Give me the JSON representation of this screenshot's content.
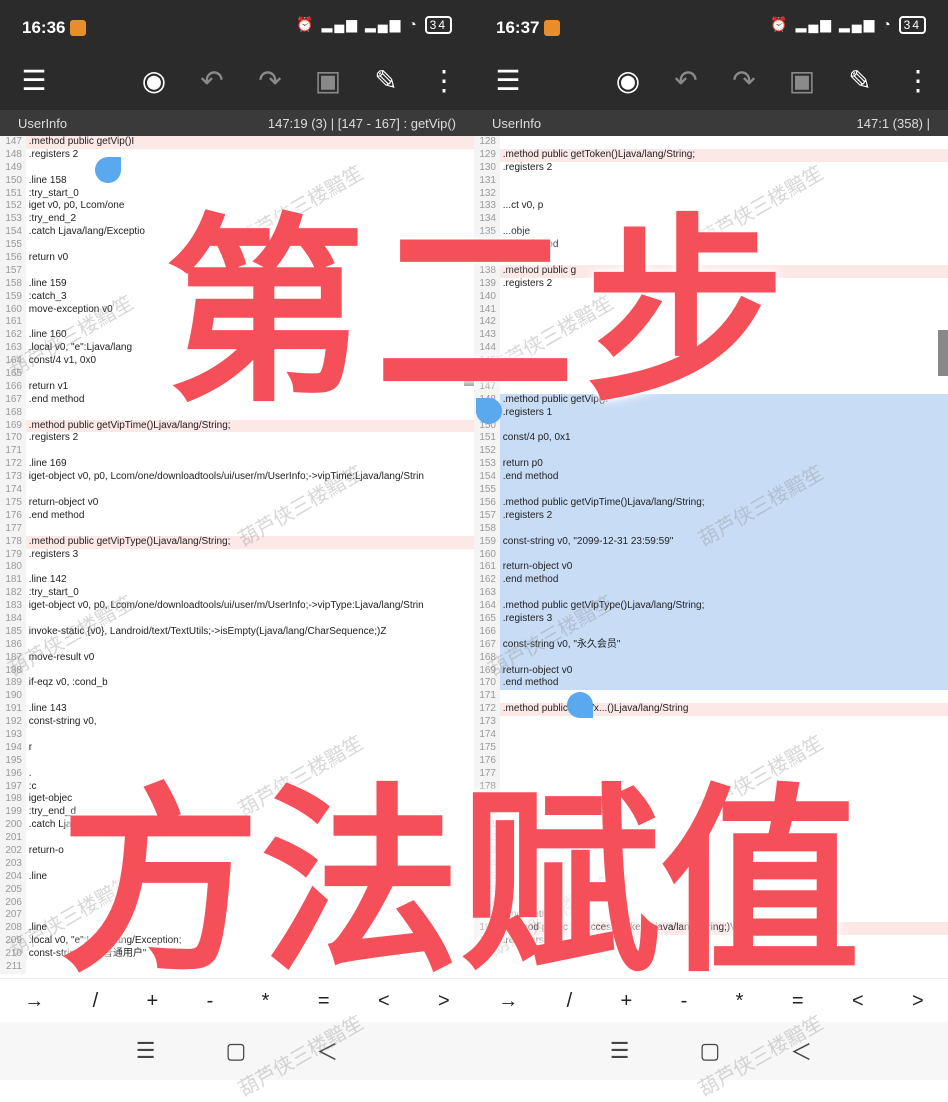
{
  "left": {
    "status_time": "16:36",
    "file": "UserInfo",
    "pos": "147:19 (3)  |  [147 - 167] : getVip()",
    "lines": [
      {
        "n": "147",
        "t": ".method public getVip()I",
        "c": "hl"
      },
      {
        "n": "148",
        "t": "    .registers 2"
      },
      {
        "n": "149",
        "t": ""
      },
      {
        "n": "150",
        "t": "    .line 158"
      },
      {
        "n": "151",
        "t": "    :try_start_0"
      },
      {
        "n": "152",
        "t": "    iget v0, p0, Lcom/one"
      },
      {
        "n": "153",
        "t": "    :try_end_2"
      },
      {
        "n": "154",
        "t": "    .catch Ljava/lang/Exceptio"
      },
      {
        "n": "155",
        "t": ""
      },
      {
        "n": "156",
        "t": "    return v0"
      },
      {
        "n": "157",
        "t": ""
      },
      {
        "n": "158",
        "t": "    .line 159"
      },
      {
        "n": "159",
        "t": "    :catch_3"
      },
      {
        "n": "160",
        "t": "    move-exception v0"
      },
      {
        "n": "161",
        "t": ""
      },
      {
        "n": "162",
        "t": "    .line 160"
      },
      {
        "n": "163",
        "t": "    .local v0, \"e\":Ljava/lang"
      },
      {
        "n": "164",
        "t": "    const/4 v1, 0x0"
      },
      {
        "n": "165",
        "t": ""
      },
      {
        "n": "166",
        "t": "    return v1"
      },
      {
        "n": "167",
        "t": ".end method"
      },
      {
        "n": "168",
        "t": ""
      },
      {
        "n": "169",
        "t": ".method public getVipTime()Ljava/lang/String;",
        "c": "hl"
      },
      {
        "n": "170",
        "t": "    .registers 2"
      },
      {
        "n": "171",
        "t": ""
      },
      {
        "n": "172",
        "t": "    .line 169"
      },
      {
        "n": "173",
        "t": "    iget-object v0, p0, Lcom/one/downloadtools/ui/user/m/UserInfo;->vipTime:Ljava/lang/Strin"
      },
      {
        "n": "174",
        "t": ""
      },
      {
        "n": "175",
        "t": "    return-object v0"
      },
      {
        "n": "176",
        "t": ".end method"
      },
      {
        "n": "177",
        "t": ""
      },
      {
        "n": "178",
        "t": ".method public getVipType()Ljava/lang/String;",
        "c": "hl"
      },
      {
        "n": "179",
        "t": "    .registers 3"
      },
      {
        "n": "180",
        "t": ""
      },
      {
        "n": "181",
        "t": "    .line 142"
      },
      {
        "n": "182",
        "t": "    :try_start_0"
      },
      {
        "n": "183",
        "t": "    iget-object v0, p0, Lcom/one/downloadtools/ui/user/m/UserInfo;->vipType:Ljava/lang/Strin"
      },
      {
        "n": "184",
        "t": ""
      },
      {
        "n": "185",
        "t": "    invoke-static {v0}, Landroid/text/TextUtils;->isEmpty(Ljava/lang/CharSequence;)Z"
      },
      {
        "n": "186",
        "t": ""
      },
      {
        "n": "187",
        "t": "    move-result v0"
      },
      {
        "n": "188",
        "t": ""
      },
      {
        "n": "189",
        "t": "    if-eqz v0, :cond_b"
      },
      {
        "n": "190",
        "t": ""
      },
      {
        "n": "191",
        "t": "    .line 143"
      },
      {
        "n": "192",
        "t": "    const-string v0,"
      },
      {
        "n": "193",
        "t": ""
      },
      {
        "n": "194",
        "t": "    r"
      },
      {
        "n": "195",
        "t": ""
      },
      {
        "n": "196",
        "t": "    ."
      },
      {
        "n": "197",
        "t": "    :c"
      },
      {
        "n": "198",
        "t": "    iget-objec"
      },
      {
        "n": "199",
        "t": "    :try_end_d"
      },
      {
        "n": "200",
        "t": "    .catch Lja"
      },
      {
        "n": "201",
        "t": ""
      },
      {
        "n": "202",
        "t": "    return-o"
      },
      {
        "n": "203",
        "t": ""
      },
      {
        "n": "204",
        "t": "    .line"
      },
      {
        "n": "205",
        "t": ""
      },
      {
        "n": "206",
        "t": ""
      },
      {
        "n": "207",
        "t": ""
      },
      {
        "n": "208",
        "t": "    .line"
      },
      {
        "n": "209",
        "t": "    .local v0, \"e\":Ljava/lang/Exception;"
      },
      {
        "n": "210",
        "t": "    const-string v1, \"普通用户\""
      },
      {
        "n": "211",
        "t": ""
      }
    ]
  },
  "right": {
    "status_time": "16:37",
    "file": "UserInfo",
    "pos": "147:1 (358)  |",
    "lines": [
      {
        "n": "128",
        "t": ""
      },
      {
        "n": "129",
        "t": ".method public getToken()Ljava/lang/String;",
        "c": "hl"
      },
      {
        "n": "130",
        "t": "    .registers 2"
      },
      {
        "n": "131",
        "t": ""
      },
      {
        "n": "132",
        "t": ""
      },
      {
        "n": "133",
        "t": "    ...ct v0, p"
      },
      {
        "n": "134",
        "t": ""
      },
      {
        "n": "135",
        "t": "    ...obje"
      },
      {
        "n": "136",
        "t": ".end method"
      },
      {
        "n": "137",
        "t": ""
      },
      {
        "n": "138",
        "t": ".method public g",
        "c": "hl"
      },
      {
        "n": "139",
        "t": "    .registers 2"
      },
      {
        "n": "140",
        "t": ""
      },
      {
        "n": "141",
        "t": ""
      },
      {
        "n": "142",
        "t": ""
      },
      {
        "n": "143",
        "t": ""
      },
      {
        "n": "144",
        "t": ""
      },
      {
        "n": "145",
        "t": ""
      },
      {
        "n": "146",
        "t": ".end method"
      },
      {
        "n": "147",
        "t": ""
      },
      {
        "n": "148",
        "t": ".method public getVip()I",
        "c": "sel"
      },
      {
        "n": "149",
        "t": "    .registers 1",
        "c": "sel"
      },
      {
        "n": "150",
        "t": "",
        "c": "sel"
      },
      {
        "n": "151",
        "t": "    const/4 p0, 0x1",
        "c": "sel"
      },
      {
        "n": "152",
        "t": "",
        "c": "sel"
      },
      {
        "n": "153",
        "t": "    return p0",
        "c": "sel"
      },
      {
        "n": "154",
        "t": ".end method",
        "c": "sel"
      },
      {
        "n": "155",
        "t": "",
        "c": "sel"
      },
      {
        "n": "156",
        "t": ".method public getVipTime()Ljava/lang/String;",
        "c": "sel"
      },
      {
        "n": "157",
        "t": "    .registers 2",
        "c": "sel"
      },
      {
        "n": "158",
        "t": "",
        "c": "sel"
      },
      {
        "n": "159",
        "t": "    const-string v0, \"2099-12-31 23:59:59\"",
        "c": "sel"
      },
      {
        "n": "160",
        "t": "",
        "c": "sel"
      },
      {
        "n": "161",
        "t": "    return-object v0",
        "c": "sel"
      },
      {
        "n": "162",
        "t": ".end method",
        "c": "sel"
      },
      {
        "n": "163",
        "t": "",
        "c": "sel"
      },
      {
        "n": "164",
        "t": ".method public getVipType()Ljava/lang/String;",
        "c": "sel"
      },
      {
        "n": "165",
        "t": "    .registers 3",
        "c": "sel"
      },
      {
        "n": "166",
        "t": "",
        "c": "sel"
      },
      {
        "n": "167",
        "t": "    const-string v0, \"永久会员\"",
        "c": "sel"
      },
      {
        "n": "168",
        "t": "",
        "c": "sel"
      },
      {
        "n": "169",
        "t": "    return-object v0",
        "c": "sel"
      },
      {
        "n": "170",
        "t": ".end method",
        "c": "sel"
      },
      {
        "n": "171",
        "t": ""
      },
      {
        "n": "172",
        "t": ".method public getWx...()Ljava/lang/String",
        "c": "hl"
      },
      {
        "n": "173",
        "t": ""
      },
      {
        "n": "174",
        "t": ""
      },
      {
        "n": "175",
        "t": ""
      },
      {
        "n": "176",
        "t": ""
      },
      {
        "n": "177",
        "t": ""
      },
      {
        "n": "178",
        "t": ""
      },
      {
        "n": "179",
        "t": ""
      },
      {
        "n": "180",
        "t": ""
      },
      {
        "n": "181",
        "t": ""
      },
      {
        "n": "182",
        "t": ""
      },
      {
        "n": "183",
        "t": ""
      },
      {
        "n": "184",
        "t": ""
      },
      {
        "n": "185",
        "t": ""
      },
      {
        "n": "186",
        "t": ""
      },
      {
        "n": "187",
        "t": ""
      },
      {
        "n": "188",
        "t": ".end method"
      },
      {
        "n": "189",
        "t": ".method public setAccess_token(Ljava/lang/String;)V",
        "c": "hl"
      },
      {
        "n": "190",
        "t": "    .registers 2"
      }
    ]
  },
  "keys": [
    "→",
    "/",
    "+",
    "-",
    "*",
    "=",
    "<",
    ">"
  ],
  "overlay_top": "第二步",
  "overlay_bottom": "方法赋值",
  "watermark": "葫芦侠三楼黯笙",
  "battery": "34"
}
